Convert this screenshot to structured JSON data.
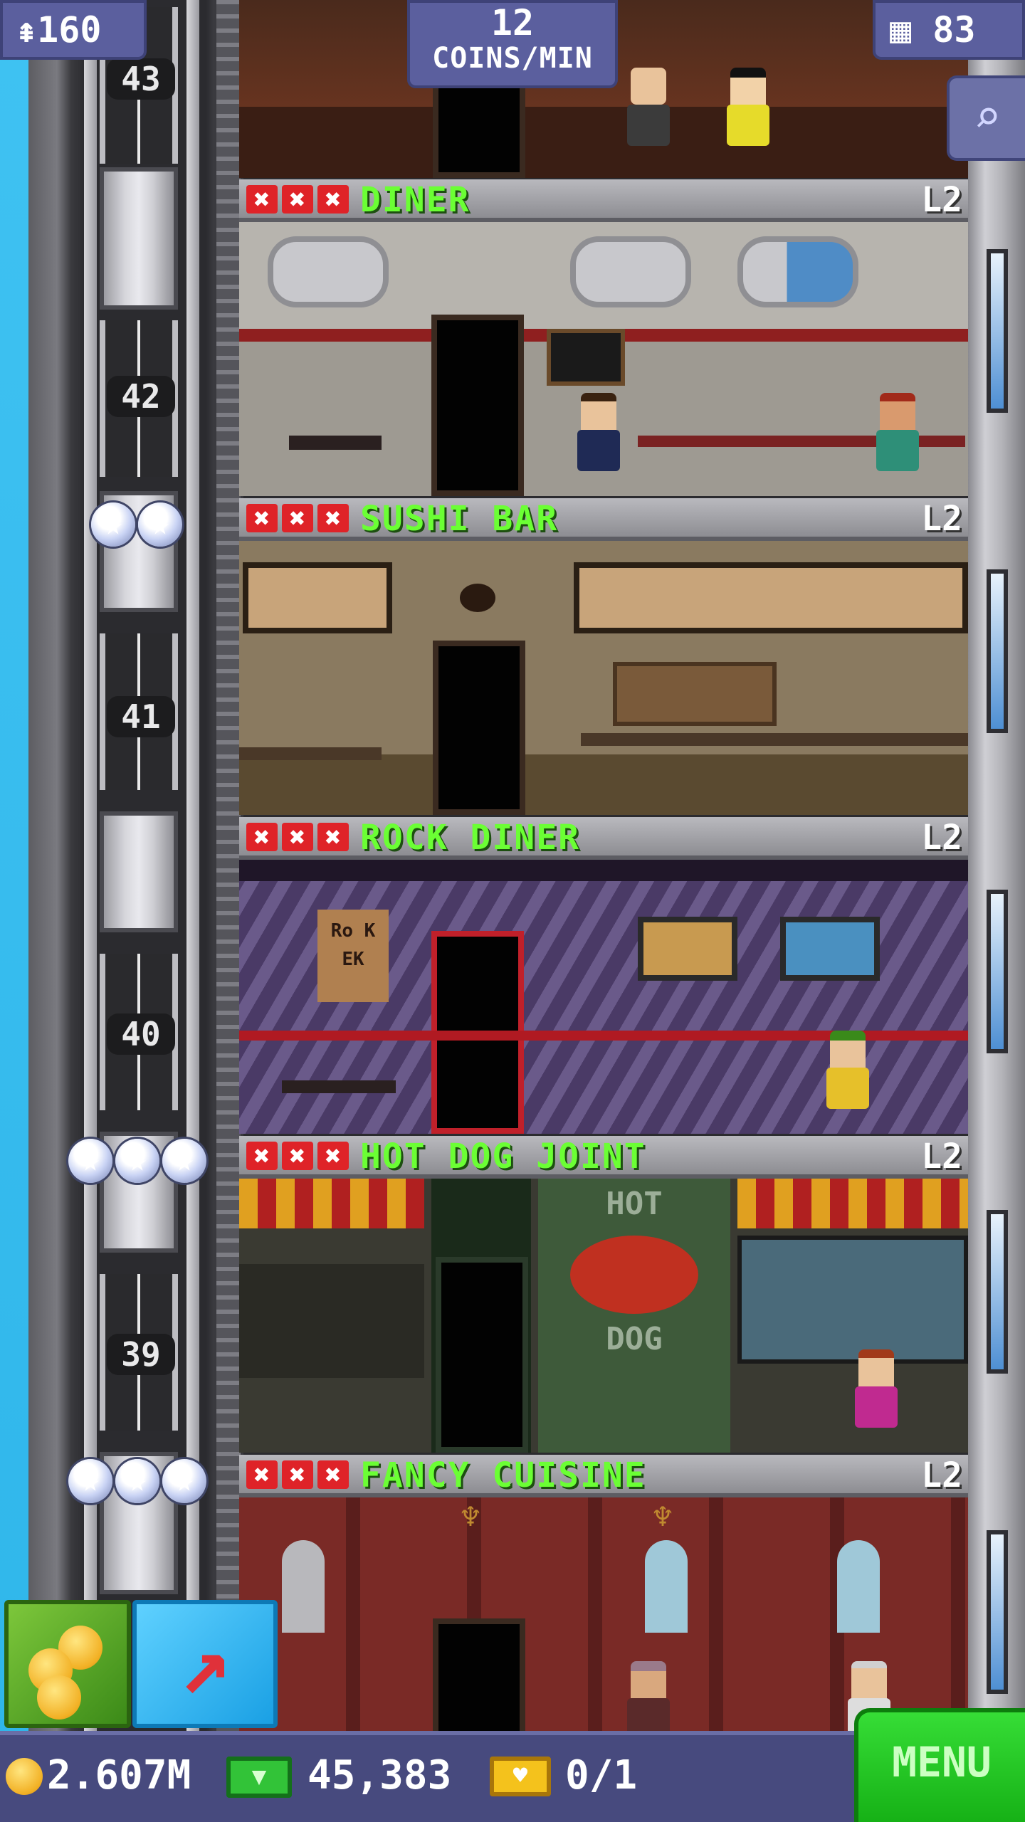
{
  "hud": {
    "population": "160",
    "population_icon": "person-up-icon",
    "coins_per_min_value": "12",
    "coins_per_min_unit": "COINS/MIN",
    "floors_count": "83",
    "floors_icon": "building-icon",
    "search_icon": "magnifier-icon"
  },
  "elevator": {
    "floor_numbers": [
      "43",
      "42",
      "41",
      "40",
      "39"
    ]
  },
  "floors": [
    {
      "name": "DINER",
      "level": "L2",
      "stock_marks": 3
    },
    {
      "name": "SUSHI BAR",
      "level": "L2",
      "stock_marks": 3
    },
    {
      "name": "ROCK DINER",
      "level": "L2",
      "stock_marks": 3
    },
    {
      "name": "HOT DOG JOINT",
      "level": "L2",
      "stock_marks": 3
    },
    {
      "name": "FANCY CUISINE",
      "level": "L2",
      "stock_marks": 3
    }
  ],
  "room_signage": {
    "hot_dog_top": "HOT",
    "hot_dog_bottom": "DOG",
    "rock_poster": "Ro K",
    "rock_poster_2": "EK"
  },
  "bottom_bar": {
    "coins": "2.607M",
    "bux": "45,383",
    "tickets": "0/1",
    "menu_label": "MENU"
  },
  "colors": {
    "floor_name": "#6bff34",
    "stock_x": "#df2328",
    "hud_bg": "#5b5f9e",
    "menu_bg": "#16b116",
    "sky": "#3cc0ef"
  }
}
